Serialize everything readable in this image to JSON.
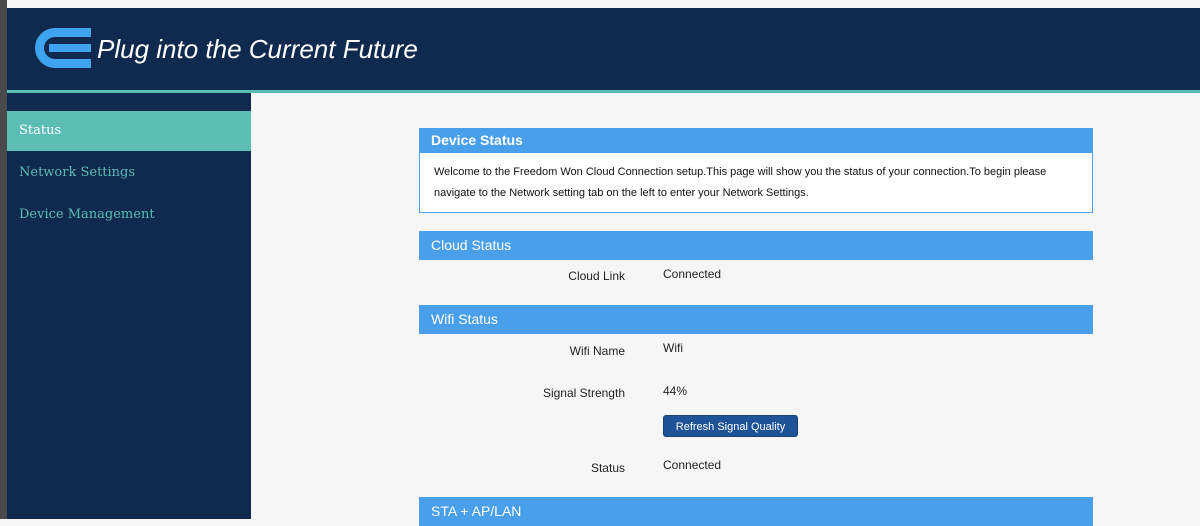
{
  "header": {
    "slogan": "Plug into the Current Future",
    "logo": "e-logo-icon"
  },
  "sidebar": {
    "items": [
      {
        "label": "Status",
        "active": true
      },
      {
        "label": "Network Settings",
        "active": false
      },
      {
        "label": "Device Management",
        "active": false
      }
    ]
  },
  "device_status": {
    "title": "Device Status",
    "text": "Welcome to the Freedom Won Cloud Connection setup.This page will show you the status of your connection.To begin please navigate to the Network setting tab on the left to enter your Network Settings."
  },
  "cloud_status": {
    "title": "Cloud Status",
    "cloud_link_label": "Cloud Link",
    "cloud_link_value": "Connected"
  },
  "wifi_status": {
    "title": "Wifi Status",
    "wifi_name_label": "Wifi Name",
    "wifi_name_value": "Wifi",
    "signal_label": "Signal Strength",
    "signal_value": "44%",
    "refresh_button": "Refresh Signal Quality",
    "status_label": "Status",
    "status_value": "Connected"
  },
  "sta_ap_lan": {
    "title": "STA + AP/LAN"
  },
  "colors": {
    "navy": "#0f2a4e",
    "teal": "#5bbdb4",
    "panel_blue": "#4a9fea",
    "button_blue": "#1f5398"
  }
}
